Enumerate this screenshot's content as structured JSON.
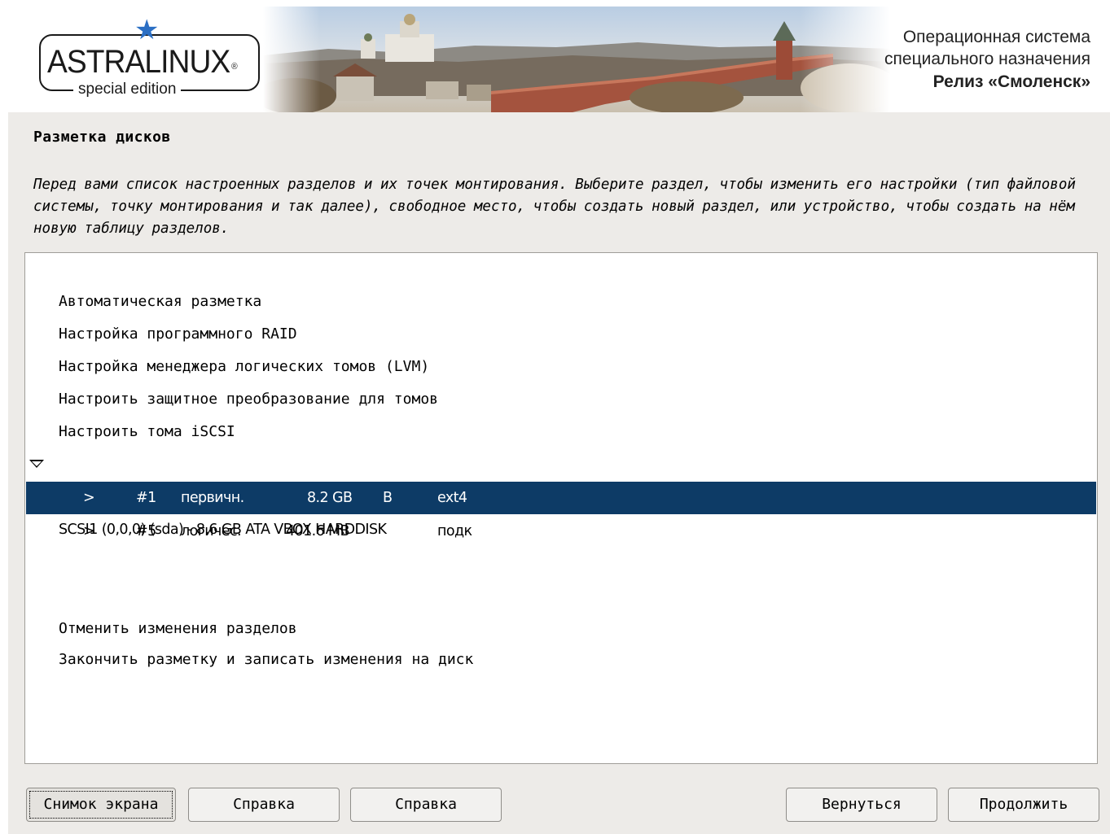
{
  "header": {
    "logo_title": "ASTRALINUX",
    "logo_registered": "®",
    "logo_subtitle": "special edition",
    "os_line1": "Операционная система",
    "os_line2": "специального назначения",
    "release": "Релиз «Смоленск»"
  },
  "page": {
    "title": "Разметка дисков",
    "description": "Перед вами список настроенных разделов и их точек монтирования. Выберите раздел, чтобы изменить его настройки (тип файловой системы, точку монтирования и так далее), свободное место, чтобы создать новый раздел, или устройство, чтобы создать на нём новую таблицу разделов."
  },
  "menu": {
    "auto_partition": "Автоматическая разметка",
    "software_raid": "Настройка программного RAID",
    "lvm": "Настройка менеджера логических томов (LVM)",
    "encryption": "Настроить защитное преобразование для томов",
    "iscsi": "Настроить тома iSCSI",
    "disk": "SCSI1 (0,0,0) (sda) - 8.6 GB ATA VBOX HARDDISK",
    "partitions": [
      {
        "arrow": ">",
        "number": "#1",
        "type": "первичн.",
        "size": "8.2 GB",
        "flag": "B",
        "fs": "ext4",
        "selected": true
      },
      {
        "arrow": ">",
        "number": "#5",
        "type": "логичес.",
        "size": "401.6 MB",
        "flag": "",
        "fs": "подк",
        "selected": false
      }
    ],
    "undo": "Отменить изменения разделов",
    "finish": "Закончить разметку и записать изменения на диск"
  },
  "buttons": {
    "screenshot": "Снимок экрана",
    "help1": "Справка",
    "help2": "Справка",
    "back": "Вернуться",
    "continue": "Продолжить"
  },
  "colors": {
    "selection": "#0d3b66",
    "panel_bg": "#edebe8",
    "logo_star": "#2b6fc4"
  }
}
